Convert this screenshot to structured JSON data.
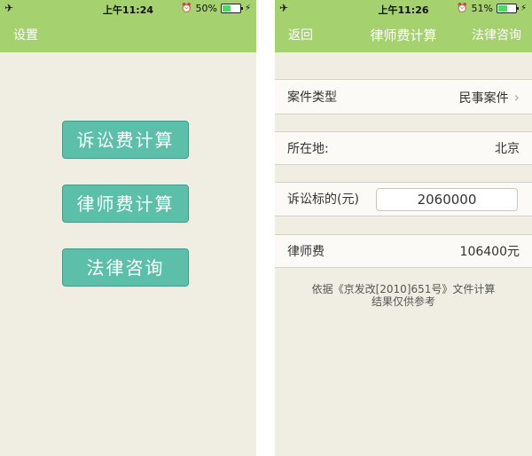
{
  "left_screen": {
    "status": {
      "time": "上午11:24",
      "battery": "50%",
      "battery_level": 0.5
    },
    "nav": {
      "left": "设置"
    },
    "buttons": [
      "诉讼费计算",
      "律师费计算",
      "法律咨询"
    ]
  },
  "right_screen": {
    "status": {
      "time": "上午11:26",
      "battery": "51%",
      "battery_level": 0.51
    },
    "nav": {
      "left": "返回",
      "title": "律师费计算",
      "right": "法律咨询"
    },
    "rows": {
      "case_type": {
        "label": "案件类型",
        "value": "民事案件"
      },
      "location": {
        "label": "所在地:",
        "value": "北京"
      },
      "amount": {
        "label": "诉讼标的(元)",
        "value": "2060000"
      },
      "fee": {
        "label": "律师费",
        "value": "106400元"
      }
    },
    "note": [
      "依据《京发改[2010]651号》文件计算",
      "结果仅供参考"
    ]
  },
  "colors": {
    "header": "#a5d16f",
    "button": "#5bbfa9",
    "background": "#f0ede3"
  }
}
